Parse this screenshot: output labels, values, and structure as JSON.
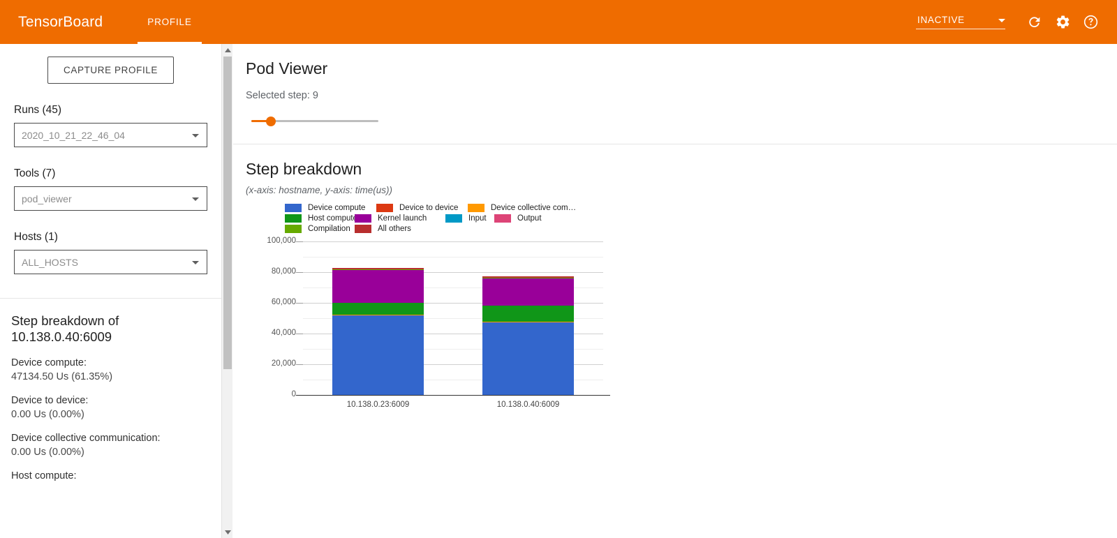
{
  "appbar": {
    "brand": "TensorBoard",
    "tabs": [
      {
        "label": "PROFILE",
        "active": true
      }
    ],
    "run_state": "INACTIVE",
    "icons": {
      "reload": "reload-icon",
      "settings": "gear-icon",
      "help": "help-icon",
      "dropdown": "chevron-down-icon"
    },
    "bg_color": "#ef6c00"
  },
  "sidebar": {
    "capture_button": "CAPTURE PROFILE",
    "fields": [
      {
        "label": "Runs (45)",
        "value": "2020_10_21_22_46_04",
        "name": "runs"
      },
      {
        "label": "Tools (7)",
        "value": "pod_viewer",
        "name": "tools"
      },
      {
        "label": "Hosts (1)",
        "value": "ALL_HOSTS",
        "name": "hosts"
      }
    ],
    "stats_title": "Step breakdown of 10.138.0.40:6009",
    "stats": [
      {
        "name": "Device compute:",
        "value": "47134.50 Us (61.35%)"
      },
      {
        "name": "Device to device:",
        "value": "0.00 Us (0.00%)"
      },
      {
        "name": "Device collective communication:",
        "value": "0.00 Us (0.00%)"
      },
      {
        "name": "Host compute:",
        "value": ""
      }
    ]
  },
  "main": {
    "page_title": "Pod Viewer",
    "selected_step_label": "Selected step: 9",
    "slider": {
      "value": 9,
      "percent": 15,
      "accent": "#ef6c00"
    },
    "card_title": "Step breakdown",
    "card_subtitle": "(x-axis: hostname, y-axis: time(us))"
  },
  "chart_data": {
    "type": "bar",
    "title": "Step breakdown",
    "subtitle": "(x-axis: hostname, y-axis: time(us))",
    "xlabel": "hostname",
    "ylabel": "time(us)",
    "stacked": true,
    "grid": true,
    "legend_position": "top",
    "ylim": [
      0,
      100000
    ],
    "yticks": [
      0,
      20000,
      40000,
      60000,
      80000,
      100000
    ],
    "ytick_labels": [
      "0",
      "20,000",
      "40,000",
      "60,000",
      "80,000",
      "100,000"
    ],
    "minor_yticks": [
      10000,
      30000,
      50000,
      70000,
      90000
    ],
    "categories": [
      "10.138.0.23:6009",
      "10.138.0.40:6009"
    ],
    "series": [
      {
        "name": "Device compute",
        "color": "#3366cc",
        "values": [
          51600,
          47134
        ]
      },
      {
        "name": "Device to device",
        "color": "#dc3912",
        "values": [
          0,
          0
        ]
      },
      {
        "name": "Device collective com…",
        "color": "#ff9900",
        "values": [
          500,
          500
        ]
      },
      {
        "name": "Host compute",
        "color": "#109618",
        "values": [
          8100,
          10600
        ]
      },
      {
        "name": "Kernel launch",
        "color": "#990099",
        "values": [
          21300,
          17600
        ]
      },
      {
        "name": "Input",
        "color": "#0099c6",
        "values": [
          0,
          0
        ]
      },
      {
        "name": "Output",
        "color": "#dd4477",
        "values": [
          0,
          0
        ]
      },
      {
        "name": "Compilation",
        "color": "#66aa00",
        "values": [
          400,
          400
        ]
      },
      {
        "name": "All others",
        "color": "#b82e2e",
        "values": [
          900,
          900
        ]
      }
    ],
    "totals": [
      82800,
      77134
    ]
  }
}
